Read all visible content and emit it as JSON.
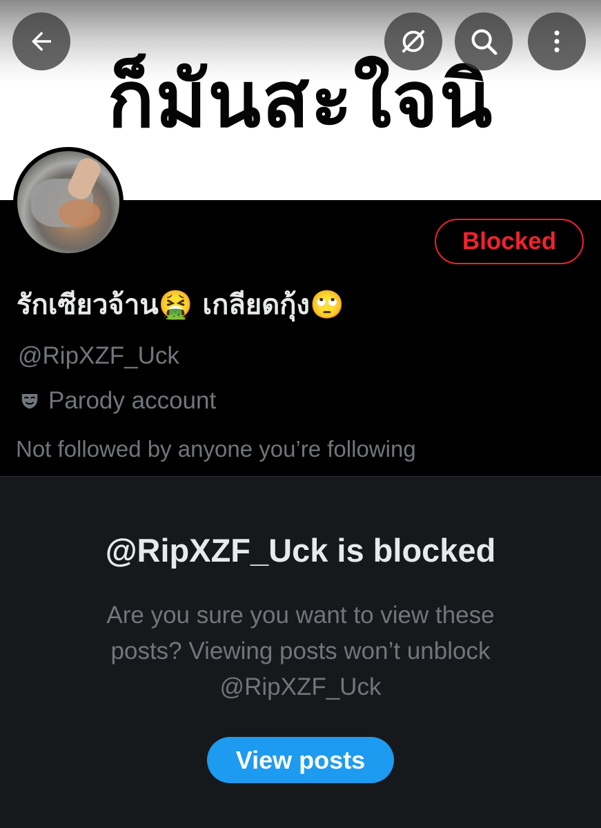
{
  "banner": {
    "text": "ก็มันสะใจนิ"
  },
  "nav": {
    "back_icon": "arrow-left-icon",
    "grok_icon": "grok-icon",
    "search_icon": "search-icon",
    "more_icon": "more-vertical-icon"
  },
  "profile": {
    "display_name": "รักเซียวจ้าน🤮 เกลียดกุ้ง🙄",
    "handle": "@RipXZF_Uck",
    "parody_label": "Parody account",
    "parody_icon": "parody-mask-icon",
    "followers_note": "Not followed by anyone you’re following",
    "blocked_button_label": "Blocked"
  },
  "blocked_notice": {
    "title": "@RipXZF_Uck is blocked",
    "description": "Are you sure you want to view these posts? Viewing posts won’t unblock @RipXZF_Uck",
    "view_posts_label": "View posts"
  },
  "colors": {
    "accent_blue": "#1d9bf0",
    "blocked_red": "#f4212e",
    "secondary_text": "#71767b",
    "primary_text": "#e7e9ea",
    "panel_bg": "#16181c"
  }
}
